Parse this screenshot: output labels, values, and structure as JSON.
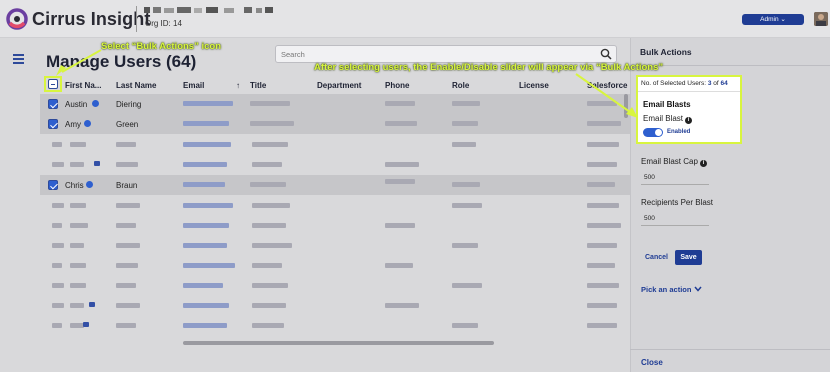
{
  "app": {
    "brand": "Cirrus Insight",
    "org_id": "Org ID: 14",
    "admin_label": "Admin ⌄"
  },
  "page": {
    "title": "Manage Users (64)",
    "search_placeholder": "Search"
  },
  "table": {
    "columns": [
      "First Na...",
      "Last Name",
      "Email",
      "Title",
      "Department",
      "Phone",
      "Role",
      "License",
      "Salesforce L"
    ],
    "sort_indicator": "↑",
    "selected_rows": [
      {
        "first": "Austin",
        "last": "Diering"
      },
      {
        "first": "Amy",
        "last": "Green"
      },
      {
        "first": "Chris",
        "last": "Braun"
      }
    ]
  },
  "panel": {
    "title": "Bulk Actions",
    "selected_prefix": "No. of Selected Users: ",
    "selected_count": "3",
    "selected_of": " of ",
    "selected_total": "64",
    "email_blasts_heading": "Email Blasts",
    "email_blast_label": "Email Blast",
    "toggle_state_label": "Enabled",
    "toggle_on": true,
    "cap_label": "Email Blast Cap",
    "cap_value": "500",
    "recipients_label": "Recipients Per Blast",
    "recipients_value": "500",
    "cancel_label": "Cancel",
    "save_label": "Save",
    "pick_action_label": "Pick an action",
    "close_label": "Close"
  },
  "annotations": {
    "select_bulk": "Select “Bulk Actions” icon",
    "after_selecting": "After selecting users, the Enable/Disable slider will appear via “Bulk Actions”"
  },
  "colors": {
    "accent": "#1f3c94",
    "highlight": "#d8f53f",
    "checkbox": "#2e5fcf"
  },
  "icons": [
    "logo-icon",
    "menu-icon",
    "search-icon",
    "info-icon",
    "chevron-down-icon",
    "verified-badge-icon"
  ]
}
